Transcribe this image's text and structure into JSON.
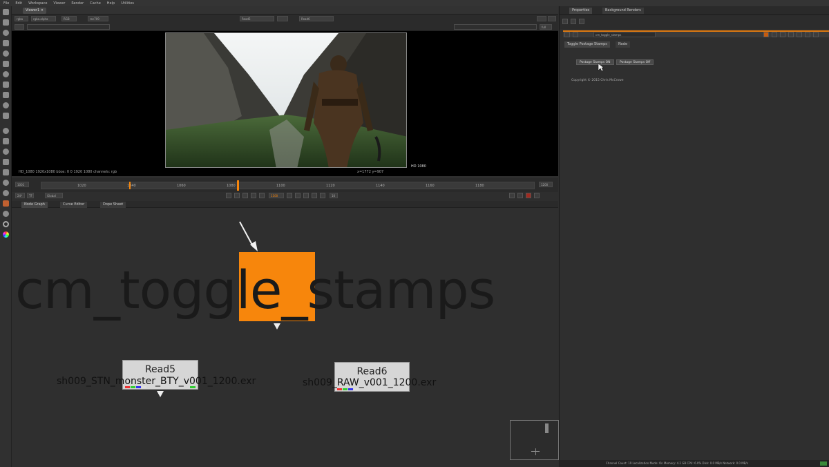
{
  "menubar": {
    "items": [
      "File",
      "Edit",
      "Workspace",
      "Viewer",
      "Render",
      "Cache",
      "Help",
      "Utilities"
    ]
  },
  "viewer": {
    "tab": "Viewer1",
    "channel_menu": "rgba",
    "alpha_menu": "rgba.alpha",
    "colorspace": "RGB",
    "lut": "rec709",
    "input_a": "Read5",
    "input_b": "Read6",
    "zoom": "60%",
    "status_left": "HD_1080 1920x1080  bbox: 0 0 1920 1080 channels: rgb",
    "status_mid": "x=1772 y=907",
    "status_right": "HD 1080",
    "proxy": "full"
  },
  "timeline": {
    "start": "1001",
    "end": "1200",
    "tick_labels": [
      "1020",
      "1040",
      "1060",
      "1080",
      "1100",
      "1120",
      "1140",
      "1160",
      "1180"
    ],
    "current_frame": "1100",
    "fps": "24*",
    "mode": "TF",
    "playback": "Global",
    "step": "10"
  },
  "panels": {
    "tabs": [
      "Node Graph",
      "Curve Editor",
      "Dope Sheet"
    ]
  },
  "nodegraph": {
    "label": "cm_toggle_stamps",
    "read5": {
      "title": "Read5",
      "file": "sh009_STN_monster_BTY_v001_1200.exr"
    },
    "read6": {
      "title": "Read6",
      "file": "sh009_RAW_v001_1200.exr"
    }
  },
  "properties": {
    "tabs": [
      "Properties",
      "Background Renders"
    ],
    "node_name": "cm_toggle_stamps",
    "node_tabs": [
      "Toggle Postage Stamps",
      "Node"
    ],
    "btn_on": "Postage Stamps ON",
    "btn_off": "Postage Stamps Off",
    "copyright": "Copyright © 2015 Chris McCrowe"
  },
  "statusbar": {
    "text": "Channel Count: 19  Localization Mode: On  Memory: 4.2 GB  CPU: 6.0%  Disk: 0.0 MB/s  Network: 0.0 MB/s"
  },
  "colors": {
    "accent": "#f7860c",
    "background": "#2f2f2f"
  }
}
